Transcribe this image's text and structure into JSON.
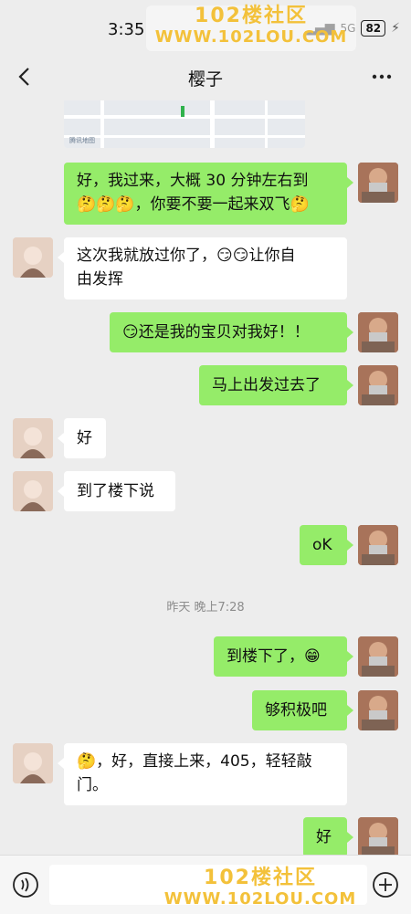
{
  "status_bar": {
    "time": "3:35",
    "network": "5G",
    "battery": "82"
  },
  "watermark": {
    "line1": "102楼社区",
    "line2": "WWW.102LOU.COM"
  },
  "header": {
    "title": "樱子",
    "back_icon": "chevron-left-icon",
    "more_icon": "more-dots-icon"
  },
  "map": {
    "logo_text": "腾讯地图"
  },
  "messages": [
    {
      "from": "self",
      "text": "好，我过来，大概 30 分钟左右到\n🤔🤔🤔，你要不要一起来双飞🤔"
    },
    {
      "from": "other",
      "text": "这次我就放过你了，😏😏让你自\n由发挥"
    },
    {
      "from": "self",
      "text": "😏还是我的宝贝对我好！！"
    },
    {
      "from": "self",
      "text": "马上出发过去了"
    },
    {
      "from": "other",
      "text": "好"
    },
    {
      "from": "other",
      "text": "到了楼下说"
    },
    {
      "from": "self",
      "text": "oK"
    },
    {
      "from": "self",
      "text": "到楼下了，😁"
    },
    {
      "from": "self",
      "text": "够积极吧"
    },
    {
      "from": "other",
      "text": "🤔，好，直接上来，405，轻轻敲\n门。"
    },
    {
      "from": "self",
      "text": "好"
    }
  ],
  "time_separator": "昨天 晚上7:28",
  "input_bar": {
    "voice_icon": "voice-icon",
    "plus_icon": "plus-circle-icon",
    "placeholder": ""
  },
  "colors": {
    "background": "#ededed",
    "self_bubble": "#95ec69",
    "other_bubble": "#ffffff"
  }
}
